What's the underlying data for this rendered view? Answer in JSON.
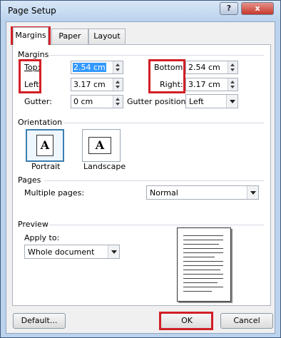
{
  "window": {
    "title": "Page Setup",
    "help_label": "?",
    "close_label": "x"
  },
  "tabs": [
    {
      "label": "Margins"
    },
    {
      "label": "Paper"
    },
    {
      "label": "Layout"
    }
  ],
  "margins": {
    "section_label": "Margins",
    "top": {
      "label": "Top:",
      "value": "2.54 cm"
    },
    "bottom": {
      "label": "Bottom:",
      "value": "2.54 cm"
    },
    "left": {
      "label": "Left:",
      "value": "3.17 cm"
    },
    "right": {
      "label": "Right:",
      "value": "3.17 cm"
    },
    "gutter": {
      "label": "Gutter:",
      "value": "0 cm"
    },
    "gutter_position": {
      "label": "Gutter position:",
      "value": "Left"
    }
  },
  "orientation": {
    "section_label": "Orientation",
    "portrait": "Portrait",
    "landscape": "Landscape",
    "icon_letter": "A"
  },
  "pages": {
    "section_label": "Pages",
    "multiple_pages_label": "Multiple pages:",
    "multiple_pages_value": "Normal"
  },
  "preview": {
    "section_label": "Preview",
    "apply_to_label": "Apply to:",
    "apply_to_value": "Whole document"
  },
  "buttons": {
    "default": "Default...",
    "ok": "OK",
    "cancel": "Cancel"
  },
  "colors": {
    "highlight": "#d21f26",
    "selection": "#3399ff"
  }
}
